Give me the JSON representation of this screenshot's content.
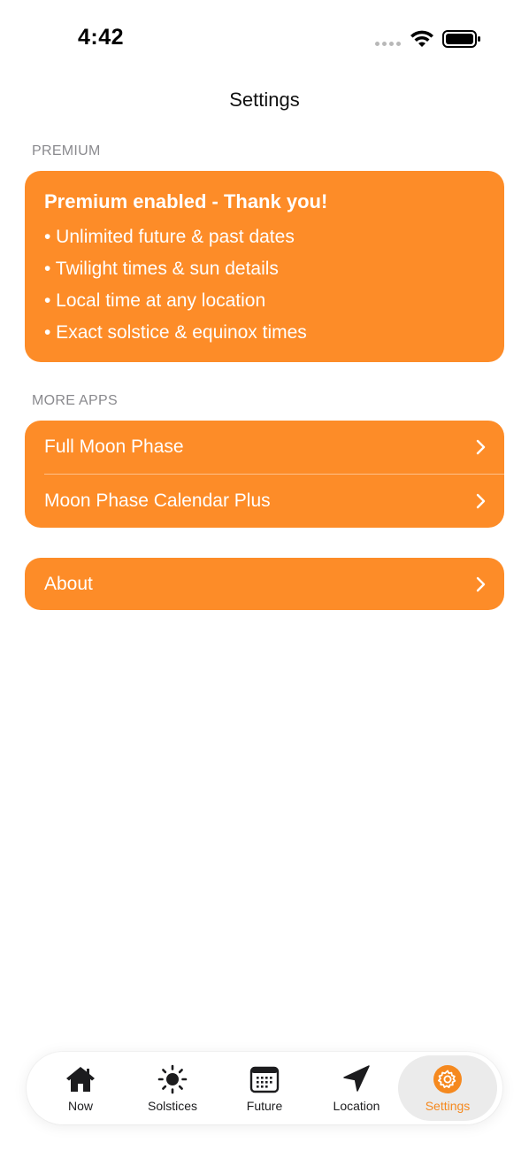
{
  "status_bar": {
    "time": "4:42"
  },
  "nav": {
    "title": "Settings"
  },
  "premium_section": {
    "header": "PREMIUM",
    "title": "Premium enabled - Thank you!",
    "features": [
      "• Unlimited future & past dates",
      "• Twilight times & sun details",
      "• Local time at any location",
      "• Exact solstice & equinox times"
    ]
  },
  "more_apps_section": {
    "header": "MORE APPS",
    "items": [
      {
        "label": "Full Moon Phase"
      },
      {
        "label": "Moon Phase Calendar Plus"
      }
    ]
  },
  "about": {
    "label": "About"
  },
  "tab_bar": {
    "tabs": [
      {
        "label": "Now",
        "icon": "house-icon"
      },
      {
        "label": "Solstices",
        "icon": "sun-icon"
      },
      {
        "label": "Future",
        "icon": "calendar-icon"
      },
      {
        "label": "Location",
        "icon": "location-arrow-icon"
      },
      {
        "label": "Settings",
        "icon": "gear-icon",
        "active": true
      }
    ]
  },
  "colors": {
    "accent": "#fd8c28",
    "active_tab_label": "#f5891f",
    "section_header": "#8a8a8e"
  }
}
